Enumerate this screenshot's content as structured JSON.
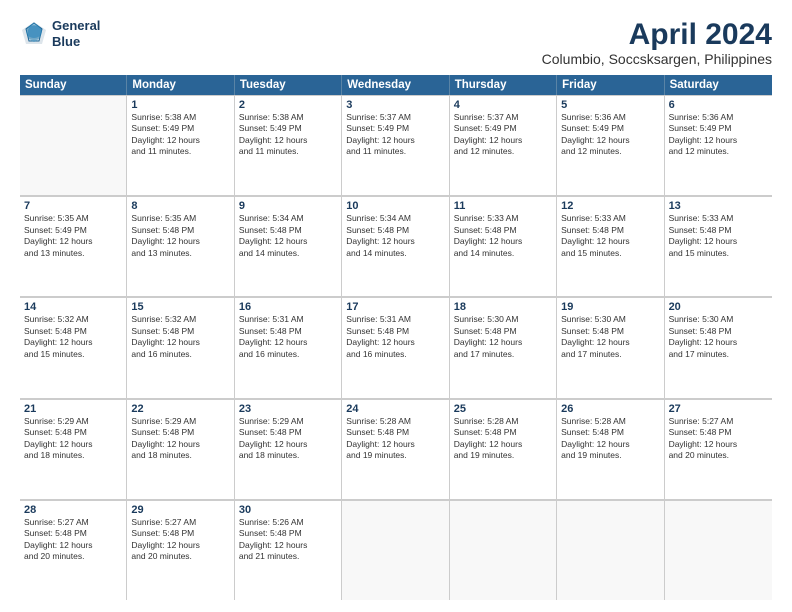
{
  "header": {
    "logo_line1": "General",
    "logo_line2": "Blue",
    "title": "April 2024",
    "subtitle": "Columbio, Soccsksargen, Philippines"
  },
  "days": [
    "Sunday",
    "Monday",
    "Tuesday",
    "Wednesday",
    "Thursday",
    "Friday",
    "Saturday"
  ],
  "weeks": [
    [
      {
        "day": "",
        "lines": []
      },
      {
        "day": "1",
        "lines": [
          "Sunrise: 5:38 AM",
          "Sunset: 5:49 PM",
          "Daylight: 12 hours",
          "and 11 minutes."
        ]
      },
      {
        "day": "2",
        "lines": [
          "Sunrise: 5:38 AM",
          "Sunset: 5:49 PM",
          "Daylight: 12 hours",
          "and 11 minutes."
        ]
      },
      {
        "day": "3",
        "lines": [
          "Sunrise: 5:37 AM",
          "Sunset: 5:49 PM",
          "Daylight: 12 hours",
          "and 11 minutes."
        ]
      },
      {
        "day": "4",
        "lines": [
          "Sunrise: 5:37 AM",
          "Sunset: 5:49 PM",
          "Daylight: 12 hours",
          "and 12 minutes."
        ]
      },
      {
        "day": "5",
        "lines": [
          "Sunrise: 5:36 AM",
          "Sunset: 5:49 PM",
          "Daylight: 12 hours",
          "and 12 minutes."
        ]
      },
      {
        "day": "6",
        "lines": [
          "Sunrise: 5:36 AM",
          "Sunset: 5:49 PM",
          "Daylight: 12 hours",
          "and 12 minutes."
        ]
      }
    ],
    [
      {
        "day": "7",
        "lines": [
          "Sunrise: 5:35 AM",
          "Sunset: 5:49 PM",
          "Daylight: 12 hours",
          "and 13 minutes."
        ]
      },
      {
        "day": "8",
        "lines": [
          "Sunrise: 5:35 AM",
          "Sunset: 5:48 PM",
          "Daylight: 12 hours",
          "and 13 minutes."
        ]
      },
      {
        "day": "9",
        "lines": [
          "Sunrise: 5:34 AM",
          "Sunset: 5:48 PM",
          "Daylight: 12 hours",
          "and 14 minutes."
        ]
      },
      {
        "day": "10",
        "lines": [
          "Sunrise: 5:34 AM",
          "Sunset: 5:48 PM",
          "Daylight: 12 hours",
          "and 14 minutes."
        ]
      },
      {
        "day": "11",
        "lines": [
          "Sunrise: 5:33 AM",
          "Sunset: 5:48 PM",
          "Daylight: 12 hours",
          "and 14 minutes."
        ]
      },
      {
        "day": "12",
        "lines": [
          "Sunrise: 5:33 AM",
          "Sunset: 5:48 PM",
          "Daylight: 12 hours",
          "and 15 minutes."
        ]
      },
      {
        "day": "13",
        "lines": [
          "Sunrise: 5:33 AM",
          "Sunset: 5:48 PM",
          "Daylight: 12 hours",
          "and 15 minutes."
        ]
      }
    ],
    [
      {
        "day": "14",
        "lines": [
          "Sunrise: 5:32 AM",
          "Sunset: 5:48 PM",
          "Daylight: 12 hours",
          "and 15 minutes."
        ]
      },
      {
        "day": "15",
        "lines": [
          "Sunrise: 5:32 AM",
          "Sunset: 5:48 PM",
          "Daylight: 12 hours",
          "and 16 minutes."
        ]
      },
      {
        "day": "16",
        "lines": [
          "Sunrise: 5:31 AM",
          "Sunset: 5:48 PM",
          "Daylight: 12 hours",
          "and 16 minutes."
        ]
      },
      {
        "day": "17",
        "lines": [
          "Sunrise: 5:31 AM",
          "Sunset: 5:48 PM",
          "Daylight: 12 hours",
          "and 16 minutes."
        ]
      },
      {
        "day": "18",
        "lines": [
          "Sunrise: 5:30 AM",
          "Sunset: 5:48 PM",
          "Daylight: 12 hours",
          "and 17 minutes."
        ]
      },
      {
        "day": "19",
        "lines": [
          "Sunrise: 5:30 AM",
          "Sunset: 5:48 PM",
          "Daylight: 12 hours",
          "and 17 minutes."
        ]
      },
      {
        "day": "20",
        "lines": [
          "Sunrise: 5:30 AM",
          "Sunset: 5:48 PM",
          "Daylight: 12 hours",
          "and 17 minutes."
        ]
      }
    ],
    [
      {
        "day": "21",
        "lines": [
          "Sunrise: 5:29 AM",
          "Sunset: 5:48 PM",
          "Daylight: 12 hours",
          "and 18 minutes."
        ]
      },
      {
        "day": "22",
        "lines": [
          "Sunrise: 5:29 AM",
          "Sunset: 5:48 PM",
          "Daylight: 12 hours",
          "and 18 minutes."
        ]
      },
      {
        "day": "23",
        "lines": [
          "Sunrise: 5:29 AM",
          "Sunset: 5:48 PM",
          "Daylight: 12 hours",
          "and 18 minutes."
        ]
      },
      {
        "day": "24",
        "lines": [
          "Sunrise: 5:28 AM",
          "Sunset: 5:48 PM",
          "Daylight: 12 hours",
          "and 19 minutes."
        ]
      },
      {
        "day": "25",
        "lines": [
          "Sunrise: 5:28 AM",
          "Sunset: 5:48 PM",
          "Daylight: 12 hours",
          "and 19 minutes."
        ]
      },
      {
        "day": "26",
        "lines": [
          "Sunrise: 5:28 AM",
          "Sunset: 5:48 PM",
          "Daylight: 12 hours",
          "and 19 minutes."
        ]
      },
      {
        "day": "27",
        "lines": [
          "Sunrise: 5:27 AM",
          "Sunset: 5:48 PM",
          "Daylight: 12 hours",
          "and 20 minutes."
        ]
      }
    ],
    [
      {
        "day": "28",
        "lines": [
          "Sunrise: 5:27 AM",
          "Sunset: 5:48 PM",
          "Daylight: 12 hours",
          "and 20 minutes."
        ]
      },
      {
        "day": "29",
        "lines": [
          "Sunrise: 5:27 AM",
          "Sunset: 5:48 PM",
          "Daylight: 12 hours",
          "and 20 minutes."
        ]
      },
      {
        "day": "30",
        "lines": [
          "Sunrise: 5:26 AM",
          "Sunset: 5:48 PM",
          "Daylight: 12 hours",
          "and 21 minutes."
        ]
      },
      {
        "day": "",
        "lines": []
      },
      {
        "day": "",
        "lines": []
      },
      {
        "day": "",
        "lines": []
      },
      {
        "day": "",
        "lines": []
      }
    ]
  ]
}
